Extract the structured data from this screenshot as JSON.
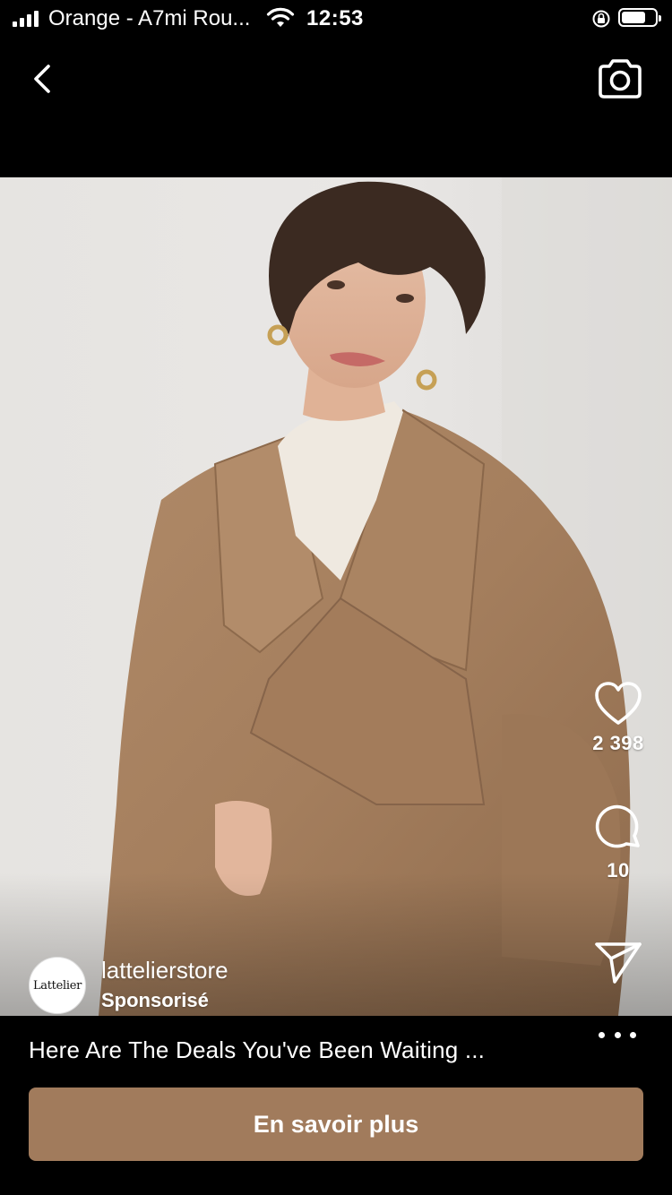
{
  "status_bar": {
    "carrier": "Orange - A7mi Rou...",
    "time": "12:53",
    "battery_level": 0.65
  },
  "top_bar": {
    "back_icon": "chevron-left-icon",
    "camera_icon": "camera-icon"
  },
  "post": {
    "account_name": "lattelierstore",
    "sponsored_label": "Sponsorisé",
    "avatar_text": "Lattelier",
    "likes": "2 398",
    "comments": "10",
    "caption": "Here Are The Deals You've Been Waiting ...",
    "cta_label": "En savoir plus"
  },
  "colors": {
    "cta_background": "#a17b5c",
    "background": "#000000"
  }
}
